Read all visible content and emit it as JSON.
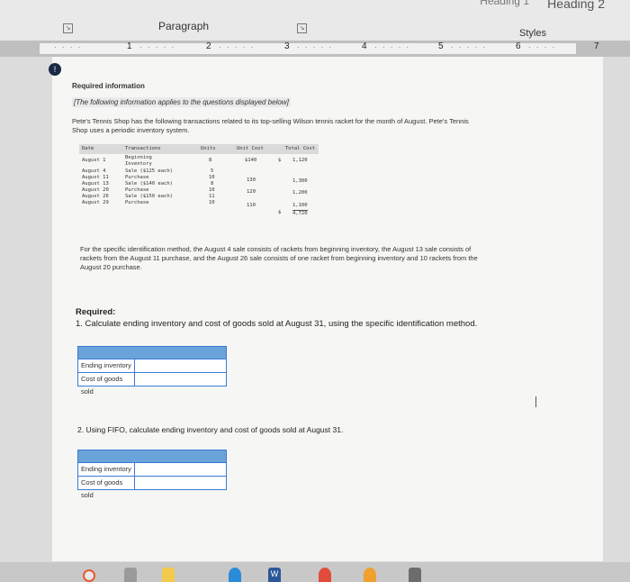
{
  "ribbon": {
    "heading_partial": "Heading 1",
    "heading_2": "Heading 2",
    "paragraph_group": "Paragraph",
    "styles_group": "Styles"
  },
  "ruler": {
    "numbers": [
      "1",
      "2",
      "3",
      "4",
      "5",
      "6",
      "7"
    ]
  },
  "document": {
    "badge": "!",
    "required_info_title": "Required information",
    "italic_note": "[The following information applies to the questions displayed below]",
    "intro": "Pete's Tennis Shop has the following transactions related to its top-selling Wilson tennis racket for the month of August. Pete's Tennis Shop uses a periodic inventory system.",
    "ledger": {
      "headers": [
        "Date",
        "Transactions",
        "Units",
        "Unit Cost",
        "Total Cost"
      ],
      "rows": [
        {
          "date": "August  1",
          "transaction": "Beginning",
          "units": "8",
          "unit_cost": "$140",
          "dollar": "$",
          "total": "1,120"
        },
        {
          "date": "",
          "transaction": "Inventory",
          "units": "",
          "unit_cost": "",
          "dollar": "",
          "total": ""
        },
        {
          "date": "August  4",
          "transaction": "Sale ($125 each)",
          "units": "5",
          "unit_cost": "",
          "dollar": "",
          "total": ""
        },
        {
          "date": "August 11",
          "transaction": "Purchase",
          "units": "10",
          "unit_cost": "130",
          "dollar": "",
          "total": "1,300"
        },
        {
          "date": "August 13",
          "transaction": "Sale ($140 each)",
          "units": "8",
          "unit_cost": "",
          "dollar": "",
          "total": ""
        },
        {
          "date": "August 20",
          "transaction": "Purchase",
          "units": "10",
          "unit_cost": "120",
          "dollar": "",
          "total": "1,200"
        },
        {
          "date": "August 26",
          "transaction": "Sale ($150 each)",
          "units": "11",
          "unit_cost": "",
          "dollar": "",
          "total": ""
        },
        {
          "date": "August 29",
          "transaction": "Purchase",
          "units": "10",
          "unit_cost": "110",
          "dollar": "",
          "total": "1,100"
        }
      ],
      "grand_total_dollar": "$",
      "grand_total": "4,720"
    },
    "specific_note": "For the specific identification method, the August 4 sale consists of rackets from beginning inventory, the August 13 sale consists of rackets from the August 11 purchase, and the August 26 sale consists of one racket from beginning inventory and 10 rackets from the August 20 purchase.",
    "required_label": "Required:",
    "question_1": "1. Calculate ending inventory and cost of goods sold at August 31, using the specific identification method.",
    "table_1": {
      "rows": [
        {
          "label": "Ending inventory",
          "value": ""
        },
        {
          "label": "Cost of goods sold",
          "value": ""
        }
      ]
    },
    "question_2": "2. Using FIFO, calculate ending inventory and cost of goods sold at August 31.",
    "table_2": {
      "rows": [
        {
          "label": "Ending inventory",
          "value": ""
        },
        {
          "label": "Cost of goods sold",
          "value": ""
        }
      ]
    }
  },
  "taskbar": {
    "icons": [
      "chrome-icon",
      "calculator-icon",
      "sticky-notes-icon",
      "edge-icon",
      "word-icon",
      "chrome-alt-icon",
      "orange-app-icon",
      "calculator-alt-icon"
    ],
    "word_letter": "W"
  },
  "colors": {
    "table_border": "#3a7bd5",
    "table_header": "#6aa2da",
    "ribbon_bg": "#e9e9e9"
  }
}
